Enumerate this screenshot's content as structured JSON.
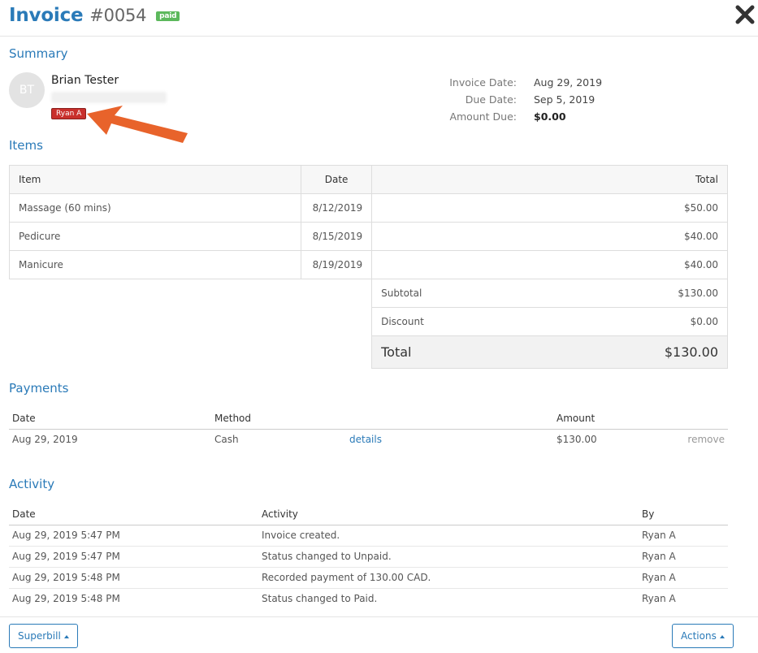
{
  "header": {
    "title": "Invoice",
    "number": "#0054",
    "status_badge": "paid"
  },
  "summary": {
    "section_title": "Summary",
    "avatar_initials": "BT",
    "client_name": "Brian Tester",
    "staff_badge": "Ryan A",
    "labels": [
      "Invoice Date:",
      "Due Date:",
      "Amount Due:"
    ],
    "invoice_date": "Aug 29, 2019",
    "due_date": "Sep 5, 2019",
    "amount_due": "$0.00"
  },
  "items": {
    "section_title": "Items",
    "columns": [
      "Item",
      "Date",
      "Total"
    ],
    "rows": [
      {
        "item": "Massage (60 mins)",
        "date": "8/12/2019",
        "total": "$50.00"
      },
      {
        "item": "Pedicure",
        "date": "8/15/2019",
        "total": "$40.00"
      },
      {
        "item": "Manicure",
        "date": "8/19/2019",
        "total": "$40.00"
      }
    ],
    "subtotal_label": "Subtotal",
    "subtotal": "$130.00",
    "discount_label": "Discount",
    "discount": "$0.00",
    "total_label": "Total",
    "total": "$130.00"
  },
  "payments": {
    "section_title": "Payments",
    "columns": [
      "Date",
      "Method",
      "Amount"
    ],
    "rows": [
      {
        "date": "Aug 29, 2019",
        "method": "Cash",
        "details": "details",
        "amount": "$130.00",
        "remove": "remove"
      }
    ]
  },
  "activity": {
    "section_title": "Activity",
    "columns": [
      "Date",
      "Activity",
      "By"
    ],
    "rows": [
      {
        "date": "Aug 29, 2019  5:47 PM",
        "activity": "Invoice created.",
        "by": "Ryan A"
      },
      {
        "date": "Aug 29, 2019  5:47 PM",
        "activity": "Status changed to Unpaid.",
        "by": "Ryan A"
      },
      {
        "date": "Aug 29, 2019  5:48 PM",
        "activity": "Recorded payment of 130.00 CAD.",
        "by": "Ryan A"
      },
      {
        "date": "Aug 29, 2019  5:48 PM",
        "activity": "Status changed to Paid.",
        "by": "Ryan A"
      }
    ]
  },
  "footer": {
    "superbill_label": "Superbill",
    "actions_label": "Actions"
  },
  "colors": {
    "accent": "#2a7ab8",
    "paid": "#5cb85c",
    "staff_badge": "#c9302c",
    "annotation_arrow": "#e8632b"
  },
  "icons": {
    "close": "close-icon",
    "caret": "caret-up-icon",
    "arrow": "annotation-arrow"
  }
}
